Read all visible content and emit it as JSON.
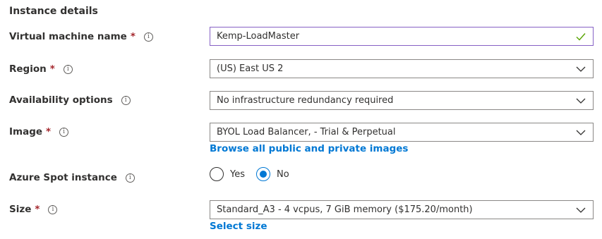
{
  "section": {
    "title": "Instance details"
  },
  "vm_name": {
    "label": "Virtual machine name",
    "required": "*",
    "info": "i",
    "value": "Kemp-LoadMaster",
    "icon": "check-icon",
    "valid_color": "#57a300"
  },
  "region": {
    "label": "Region",
    "required": "*",
    "info": "i",
    "value": "(US) East US 2",
    "icon": "chevron-down-icon"
  },
  "availability": {
    "label": "Availability options",
    "info": "i",
    "value": "No infrastructure redundancy required",
    "icon": "chevron-down-icon"
  },
  "image": {
    "label": "Image",
    "required": "*",
    "info": "i",
    "value": "BYOL Load Balancer, - Trial & Perpetual",
    "icon": "chevron-down-icon",
    "link": "Browse all public and private images"
  },
  "spot": {
    "label": "Azure Spot instance",
    "info": "i",
    "options": [
      {
        "label": "Yes",
        "selected": false
      },
      {
        "label": "No",
        "selected": true
      }
    ]
  },
  "size": {
    "label": "Size",
    "required": "*",
    "info": "i",
    "value": "Standard_A3 - 4 vcpus, 7 GiB memory ($175.20/month)",
    "icon": "chevron-down-icon",
    "link": "Select size"
  },
  "colors": {
    "accent": "#0078d4",
    "required": "#a4262c",
    "focus_border": "#8661c5",
    "border": "#8a8886"
  }
}
